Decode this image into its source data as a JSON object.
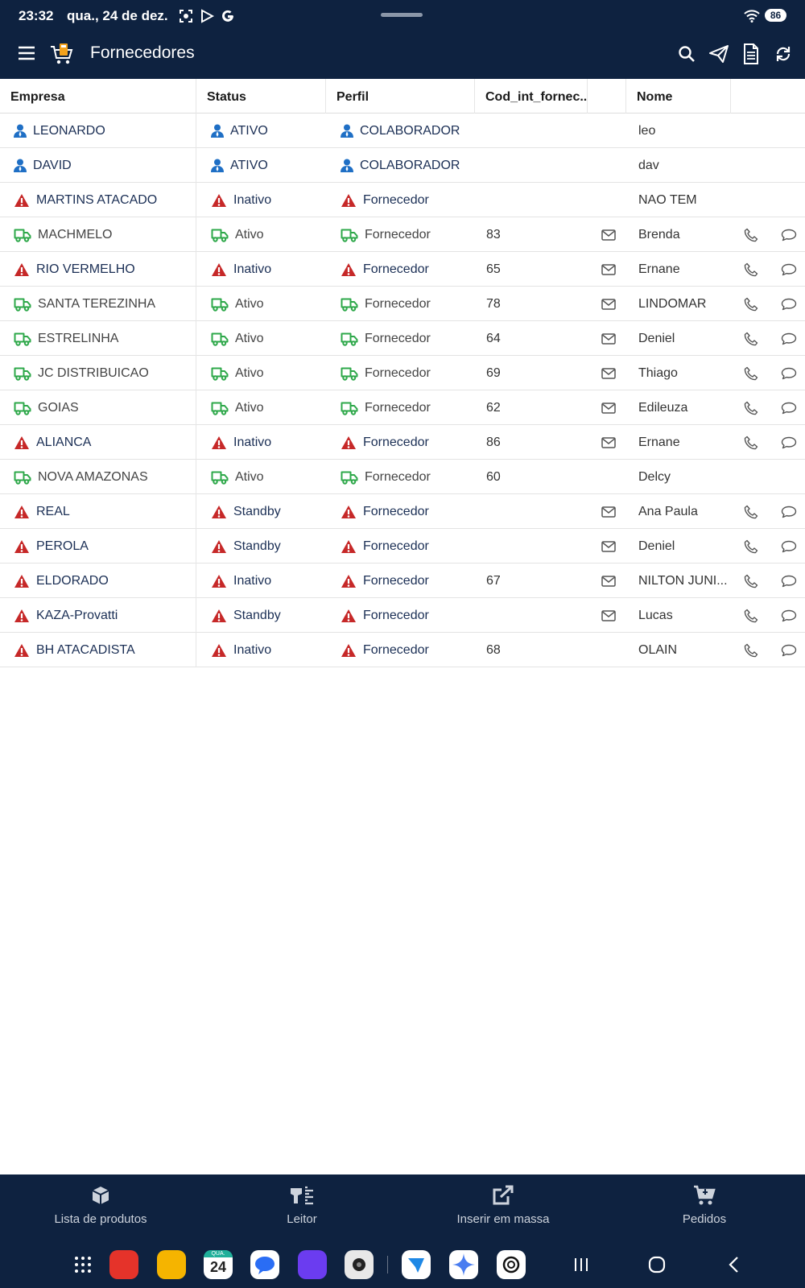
{
  "status_bar": {
    "time": "23:32",
    "date": "qua., 24 de dez.",
    "battery": "86"
  },
  "app_bar": {
    "title": "Fornecedores"
  },
  "table": {
    "headers": [
      "Empresa",
      "Status",
      "Perfil",
      "Cod_int_fornec...",
      "Nome"
    ],
    "rows": [
      {
        "type": "user",
        "empresa": "LEONARDO",
        "status": "ATIVO",
        "perfil": "COLABORADOR",
        "cod": "",
        "mail": false,
        "nome": "leo",
        "phone": false,
        "chat": false
      },
      {
        "type": "user",
        "empresa": "DAVID",
        "status": "ATIVO",
        "perfil": "COLABORADOR",
        "cod": "",
        "mail": false,
        "nome": "dav",
        "phone": false,
        "chat": false
      },
      {
        "type": "warn",
        "empresa": "MARTINS ATACADO",
        "status": "Inativo",
        "perfil": "Fornecedor",
        "cod": "",
        "mail": false,
        "nome": "NAO TEM",
        "phone": false,
        "chat": false
      },
      {
        "type": "truck",
        "empresa": "MACHMELO",
        "status": "Ativo",
        "perfil": "Fornecedor",
        "cod": "83",
        "mail": true,
        "nome": "Brenda",
        "phone": true,
        "chat": true
      },
      {
        "type": "warn",
        "empresa": "RIO VERMELHO",
        "status": "Inativo",
        "perfil": "Fornecedor",
        "cod": "65",
        "mail": true,
        "nome": "Ernane",
        "phone": true,
        "chat": true
      },
      {
        "type": "truck",
        "empresa": "SANTA TEREZINHA",
        "status": "Ativo",
        "perfil": "Fornecedor",
        "cod": "78",
        "mail": true,
        "nome": "LINDOMAR",
        "phone": true,
        "chat": true
      },
      {
        "type": "truck",
        "empresa": "ESTRELINHA",
        "status": "Ativo",
        "perfil": "Fornecedor",
        "cod": "64",
        "mail": true,
        "nome": "Deniel",
        "phone": true,
        "chat": true
      },
      {
        "type": "truck",
        "empresa": "JC DISTRIBUICAO",
        "status": "Ativo",
        "perfil": "Fornecedor",
        "cod": "69",
        "mail": true,
        "nome": "Thiago",
        "phone": true,
        "chat": true
      },
      {
        "type": "truck",
        "empresa": "GOIAS",
        "status": "Ativo",
        "perfil": "Fornecedor",
        "cod": "62",
        "mail": true,
        "nome": "Edileuza",
        "phone": true,
        "chat": true
      },
      {
        "type": "warn",
        "empresa": "ALIANCA",
        "status": "Inativo",
        "perfil": "Fornecedor",
        "cod": "86",
        "mail": true,
        "nome": "Ernane",
        "phone": true,
        "chat": true
      },
      {
        "type": "truck",
        "empresa": "NOVA AMAZONAS",
        "status": "Ativo",
        "perfil": "Fornecedor",
        "cod": "60",
        "mail": false,
        "nome": "Delcy",
        "phone": false,
        "chat": false
      },
      {
        "type": "warn",
        "empresa": "REAL",
        "status": "Standby",
        "perfil": "Fornecedor",
        "cod": "",
        "mail": true,
        "nome": "Ana Paula",
        "phone": true,
        "chat": true
      },
      {
        "type": "warn",
        "empresa": "PEROLA",
        "status": "Standby",
        "perfil": "Fornecedor",
        "cod": "",
        "mail": true,
        "nome": "Deniel",
        "phone": true,
        "chat": true
      },
      {
        "type": "warn",
        "empresa": "ELDORADO",
        "status": "Inativo",
        "perfil": "Fornecedor",
        "cod": "67",
        "mail": true,
        "nome": "NILTON JUNI...",
        "phone": true,
        "chat": true
      },
      {
        "type": "warn",
        "empresa": "KAZA-Provatti",
        "status": "Standby",
        "perfil": "Fornecedor",
        "cod": "",
        "mail": true,
        "nome": "Lucas",
        "phone": true,
        "chat": true
      },
      {
        "type": "warn",
        "empresa": "BH ATACADISTA",
        "status": "Inativo",
        "perfil": "Fornecedor",
        "cod": "68",
        "mail": false,
        "nome": "OLAIN",
        "phone": true,
        "chat": true
      }
    ]
  },
  "bottom_nav": [
    {
      "label": "Lista de produtos",
      "icon": "box-icon"
    },
    {
      "label": "Leitor",
      "icon": "barcode-scanner-icon"
    },
    {
      "label": "Inserir em massa",
      "icon": "external-edit-icon"
    },
    {
      "label": "Pedidos",
      "icon": "cart-icon"
    }
  ],
  "dock": {
    "calendar_day": "24",
    "calendar_weekday": "QUA."
  },
  "colors": {
    "bar_bg": "#0e2240",
    "user_blue": "#1f6fc5",
    "warn_red": "#c62828",
    "truck_green": "#2ea84a"
  }
}
